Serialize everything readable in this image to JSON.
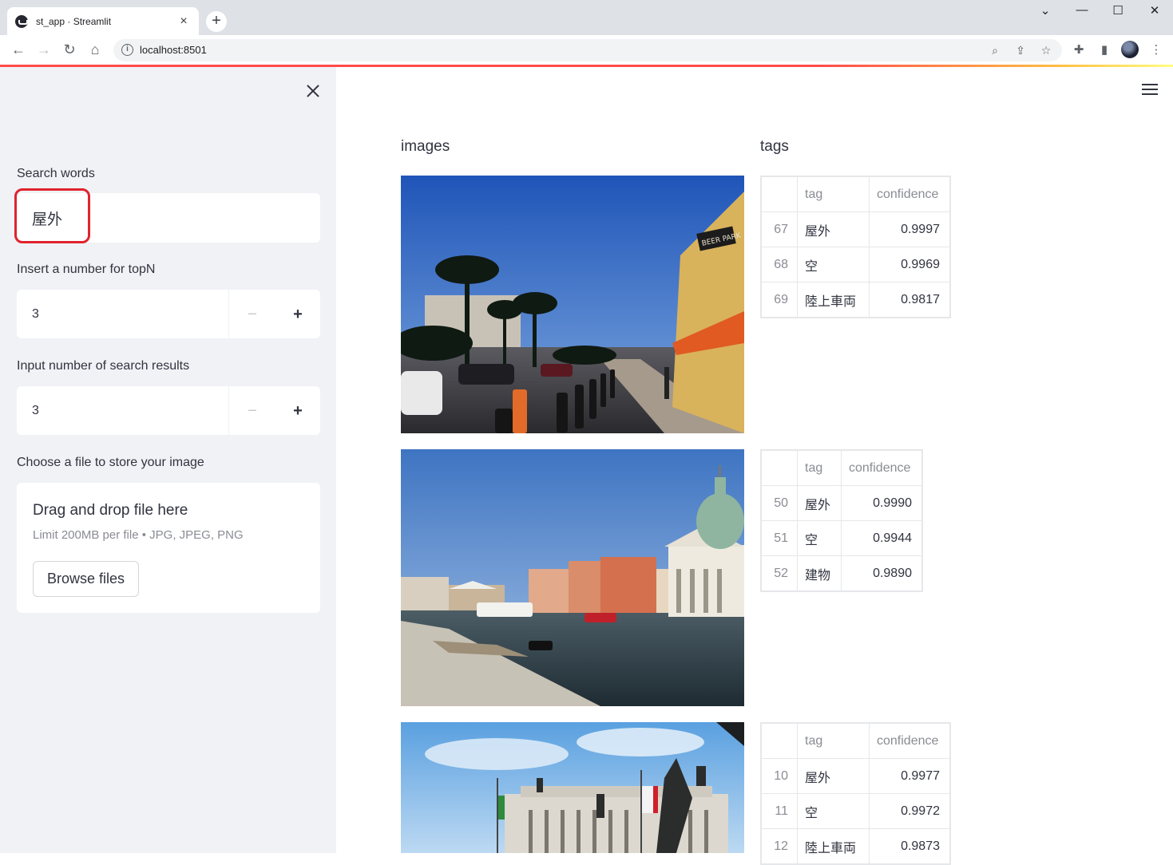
{
  "browser": {
    "tab_title": "st_app · Streamlit",
    "tab_close": "×",
    "new_tab": "+",
    "url": "localhost:8501"
  },
  "sidebar": {
    "search_label": "Search words",
    "search_value": "屋外",
    "topn_label": "Insert a number for topN",
    "topn_value": "3",
    "results_label": "Input number of search results",
    "results_value": "3",
    "file_label": "Choose a file to store your image",
    "upload_title": "Drag and drop file here",
    "upload_limit": "Limit 200MB per file • JPG, JPEG, PNG",
    "browse_label": "Browse files",
    "minus": "−",
    "plus": "+"
  },
  "main": {
    "images_header": "images",
    "tags_header": "tags",
    "results": [
      {
        "photo": "las-vegas-street",
        "sign_text": "BEER PARK",
        "columns": [
          "tag",
          "confidence"
        ],
        "rows": [
          {
            "index": "67",
            "tag": "屋外",
            "confidence": "0.9997"
          },
          {
            "index": "68",
            "tag": "空",
            "confidence": "0.9969"
          },
          {
            "index": "69",
            "tag": "陸上車両",
            "confidence": "0.9817"
          }
        ]
      },
      {
        "photo": "venice-canal",
        "columns": [
          "tag",
          "confidence"
        ],
        "rows": [
          {
            "index": "50",
            "tag": "屋外",
            "confidence": "0.9990"
          },
          {
            "index": "51",
            "tag": "空",
            "confidence": "0.9944"
          },
          {
            "index": "52",
            "tag": "建物",
            "confidence": "0.9890"
          }
        ]
      },
      {
        "photo": "rome-monument",
        "columns": [
          "tag",
          "confidence"
        ],
        "rows": [
          {
            "index": "10",
            "tag": "屋外",
            "confidence": "0.9977"
          },
          {
            "index": "11",
            "tag": "空",
            "confidence": "0.9972"
          },
          {
            "index": "12",
            "tag": "陸上車両",
            "confidence": "0.9873"
          }
        ]
      }
    ]
  }
}
